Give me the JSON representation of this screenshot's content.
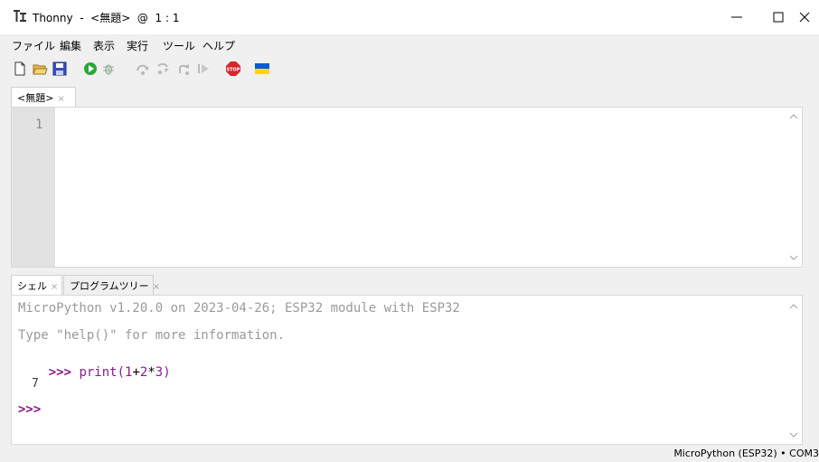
{
  "window": {
    "title": "Thonny  -  <無題>  @  1 : 1"
  },
  "menu": [
    "ファイル",
    "編集",
    "表示",
    "実行",
    "ツール",
    "ヘルプ"
  ],
  "toolbar": {
    "buttons": [
      "new-file",
      "open-file",
      "save-file",
      "run",
      "debug",
      "step-over",
      "step-into",
      "step-out",
      "resume",
      "stop",
      "support-ukraine"
    ]
  },
  "editor": {
    "tab_label": "<無題>",
    "tab_close": "×",
    "line_numbers": [
      "1"
    ],
    "content": ""
  },
  "shell": {
    "tabs": [
      {
        "label": "シェル",
        "close": "×"
      },
      {
        "label": "プログラムツリー",
        "close": "×"
      }
    ],
    "banner_line1": "MicroPython v1.20.0 on 2023-04-26; ESP32 module with ESP32",
    "banner_line2": "Type \"help()\" for more information.",
    "prompt": ">>>",
    "cmd_fn": "print(",
    "cmd_a": "1",
    "cmd_op1": "+",
    "cmd_b": "2",
    "cmd_op2": "*",
    "cmd_c": "3",
    "cmd_close": ")",
    "output": "7",
    "prompt2": ">>>"
  },
  "status": {
    "interpreter": "MicroPython (ESP32)  •  COM3"
  }
}
